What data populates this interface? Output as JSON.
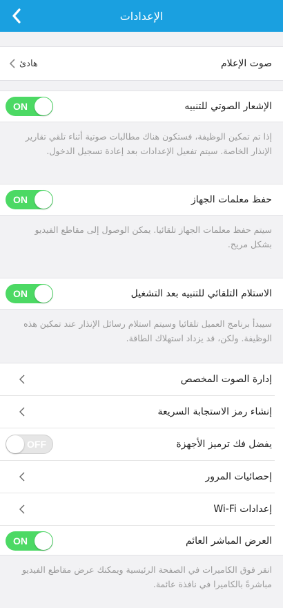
{
  "header": {
    "title": "الإعدادات",
    "back_icon": "chevron-left-icon",
    "color": "#1aa0e0"
  },
  "alarm_sound": {
    "label": "صوت الإعلام",
    "value": "هادئ"
  },
  "voice_alert": {
    "label": "الإشعار الصوتي للتنبيه",
    "state": "ON",
    "desc": "إذا تم تمكين الوظيفة، فستكون هناك مطالبات صوتية أثناء تلقي تقارير الإنذار الخاصة. سيتم تفعيل الإعدادات بعد إعادة تسجيل الدخول."
  },
  "save_params": {
    "label": "حفظ معلمات الجهاز",
    "state": "ON",
    "desc": "سيتم حفظ معلمات الجهاز تلقائيا. يمكن الوصول إلى مقاطع الفيديو بشكل مريح."
  },
  "auto_receive": {
    "label": "الاستلام التلقائي للتنبيه بعد التشغيل",
    "state": "ON",
    "desc": "سيبدأ برنامج العميل تلقائيا وسيتم استلام رسائل الإنذار عند تمكين هذه الوظيفة. ولكن، قد يزداد استهلاك الطاقة."
  },
  "menu": {
    "custom_sound": "إدارة الصوت المخصص",
    "qr_code": "إنشاء رمز الاستجابة السريعة",
    "hw_decode": {
      "label": "يفضل فك ترميز الأجهزة",
      "state": "OFF"
    },
    "traffic": "إحصائيات المرور",
    "wifi": "إعدادات Wi-Fi"
  },
  "floating_live": {
    "label": "العرض المباشر العائم",
    "state": "ON",
    "desc": "انقر فوق الكاميرات في الصفحة الرئيسية ويمكنك عرض مقاطع الفيديو مباشرةً بالكاميرا في نافذة عائمة."
  },
  "colors": {
    "toggle_on": "#4cd964",
    "toggle_off": "#e6e6e6"
  }
}
